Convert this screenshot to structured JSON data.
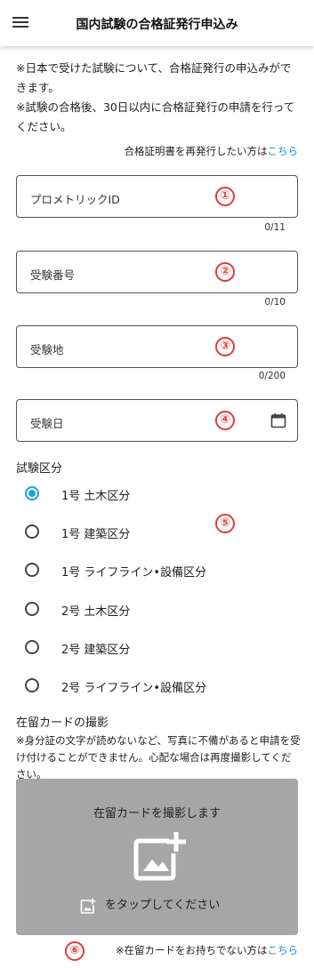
{
  "header": {
    "title": "国内試験の合格証発行申込み"
  },
  "notes": [
    "※日本で受けた試験について、合格証発行の申込みができます。",
    "※試験の合格後、30日以内に合格証発行の申請を行ってください。"
  ],
  "reissue": {
    "text": "合格証明書を再発行したい方は",
    "link": "こちら"
  },
  "fields": {
    "prometric_id": {
      "label": "プロメトリックID",
      "counter": "0/11",
      "badge": "①"
    },
    "exam_number": {
      "label": "受験番号",
      "counter": "0/10",
      "badge": "②"
    },
    "exam_place": {
      "label": "受験地",
      "counter": "0/200",
      "badge": "③"
    },
    "exam_date": {
      "label": "受験日",
      "badge": "④"
    }
  },
  "category": {
    "title": "試験区分",
    "badge": "⑤",
    "options": [
      {
        "label": "1号 土木区分",
        "checked": true
      },
      {
        "label": "1号 建築区分",
        "checked": false
      },
      {
        "label": "1号 ライフライン•設備区分",
        "checked": false
      },
      {
        "label": "2号 土木区分",
        "checked": false
      },
      {
        "label": "2号 建築区分",
        "checked": false
      },
      {
        "label": "2号 ライフライン•設備区分",
        "checked": false
      }
    ]
  },
  "card": {
    "title": "在留カードの撮影",
    "description": "※身分証の文字が読めないなど、写真に不備があると申請を受け付けることができません。心配な場合は再度撮影してください。",
    "box_title": "在留カードを撮影します",
    "tap_text": "をタップしてください",
    "icon": "add-photo-icon"
  },
  "footer": {
    "badge": "⑥",
    "text": "※在留カードをお持ちでない方は",
    "link": "こちら"
  },
  "colors": {
    "accent": "#1aa3d6",
    "badge": "#e23b3b",
    "link": "#1a8fd6",
    "photo_bg": "#a6a6a6"
  }
}
